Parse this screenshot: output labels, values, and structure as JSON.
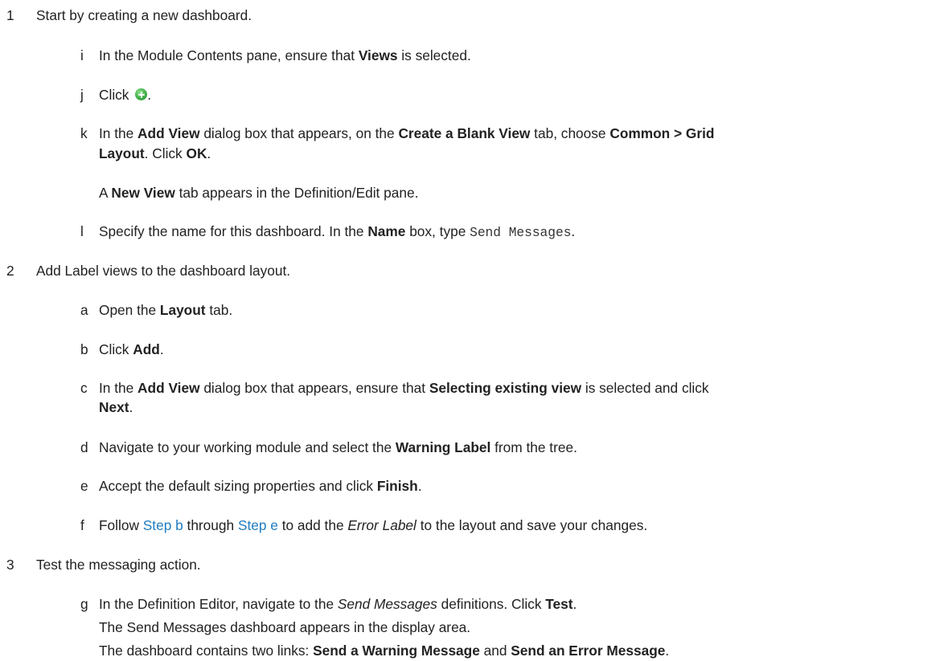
{
  "steps": [
    {
      "num": "1",
      "text": "Start by creating a new dashboard.",
      "substeps": [
        {
          "letter": "i",
          "t1": "In the Module Contents pane, ensure that ",
          "b1": "Views",
          "t2": " is selected."
        },
        {
          "letter": "j",
          "t1": "Click ",
          "icon": "add-circle-green-icon",
          "t2": "."
        },
        {
          "letter": "k",
          "t1": "In the ",
          "b1": "Add View",
          "t2": " dialog box that appears, on the ",
          "b2": "Create a Blank View",
          "t3": " tab, choose ",
          "b3": "Common > Grid",
          "b4": "Layout",
          "t4": ". Click ",
          "b5": "OK",
          "t5": "."
        },
        {
          "letter": "",
          "t1": "A ",
          "b1": "New View",
          "t2": " tab appears in the Definition/Edit pane."
        },
        {
          "letter": "l",
          "t1": "Specify the name for this dashboard. In the ",
          "b1": "Name",
          "t2": " box, type ",
          "code": "Send Messages",
          "t3": "."
        }
      ]
    },
    {
      "num": "2",
      "text": "Add Label views to the dashboard layout.",
      "substeps": [
        {
          "letter": "a",
          "t1": "Open the ",
          "b1": "Layout",
          "t2": " tab."
        },
        {
          "letter": "b",
          "t1": "Click ",
          "b1": "Add",
          "t2": "."
        },
        {
          "letter": "c",
          "t1": "In the ",
          "b1": "Add View",
          "t2": " dialog box that appears, ensure that ",
          "b2": "Selecting existing view",
          "t3": " is selected and click",
          "b3": "Next",
          "t4": "."
        },
        {
          "letter": "d",
          "t1": "Navigate to your working module and select the ",
          "b1": "Warning Label",
          "t2": " from the tree."
        },
        {
          "letter": "e",
          "t1": "Accept the default sizing properties and click ",
          "b1": "Finish",
          "t2": "."
        },
        {
          "letter": "f",
          "t1": "Follow ",
          "link1": "Step b",
          "t2": " through ",
          "link2": "Step e",
          "t3": " to add the ",
          "i1": "Error Label",
          "t4": " to the layout and save your changes."
        }
      ]
    },
    {
      "num": "3",
      "text": "Test the messaging action.",
      "substeps": [
        {
          "letter": "g",
          "t1": "In the Definition Editor, navigate to the ",
          "i1": "Send Messages",
          "t2": " definitions. Click ",
          "b1": "Test",
          "t3": "."
        },
        {
          "letter": "",
          "t1": "The Send Messages dashboard appears in the display area."
        },
        {
          "letter": "",
          "t1": "The dashboard contains two links: ",
          "b1": "Send a Warning Message",
          "t2": " and ",
          "b2": "Send an Error Message",
          "t3": "."
        }
      ]
    }
  ]
}
